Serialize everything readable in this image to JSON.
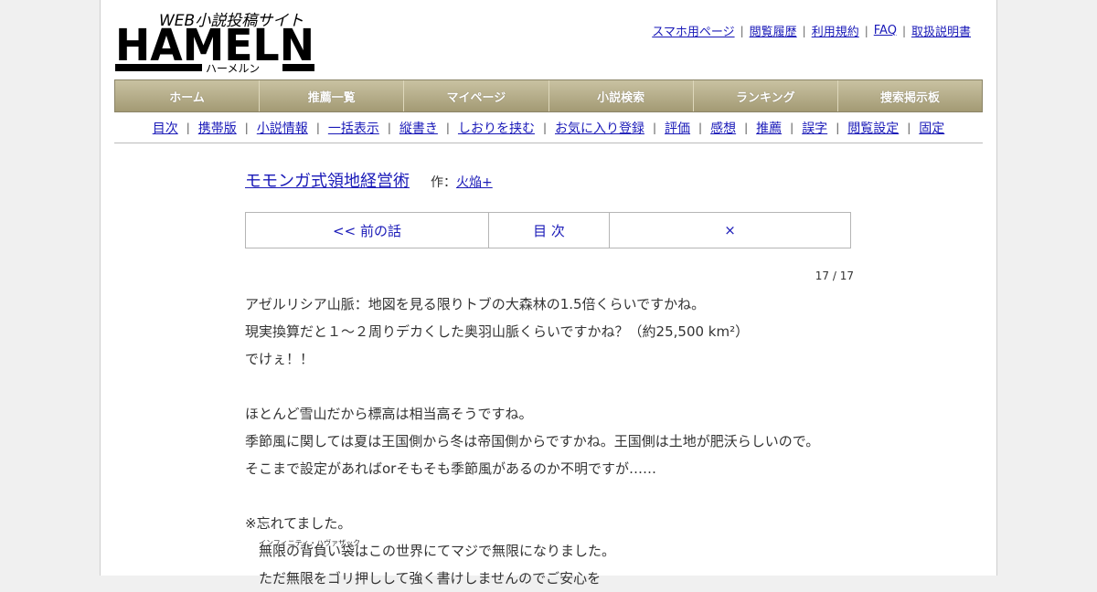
{
  "logo": {
    "tagline": "WEB小説投稿サイト",
    "wordmark": "HAMELN",
    "reading": "ハーメルン"
  },
  "top_links": [
    "スマホ用ページ",
    "閲覧履歴",
    "利用規約",
    "FAQ",
    "取扱説明書"
  ],
  "main_nav": [
    "ホーム",
    "推薦一覧",
    "マイページ",
    "小説検索",
    "ランキング",
    "捜索掲示板"
  ],
  "sub_nav": [
    "目次",
    "携帯版",
    "小説情報",
    "一括表示",
    "縦書き",
    "しおりを挟む",
    "お気に入り登録",
    "評価",
    "感想",
    "推薦",
    "誤字",
    "閲覧設定",
    "固定"
  ],
  "novel": {
    "title": "モモンガ式領地経営術",
    "author_prefix": "作：",
    "author": "火焔+"
  },
  "episode_nav": {
    "prev": "<< 前の話",
    "toc": "目 次",
    "next": "×"
  },
  "counter": "17 / 17",
  "body_lines": [
    "アゼルリシア山脈：地図を見る限りトブの大森林の1.5倍くらいですかね。",
    "現実換算だと１～２周りデカくした奥羽山脈くらいですかね？（約25,500 km²）",
    "でけぇ！！",
    "",
    "ほとんど雪山だから標高は相当高そうですね。",
    "季節風に関しては夏は王国側から冬は帝国側からですかね。王国側は土地が肥沃らしいので。",
    "そこまで設定があればorそもそも季節風があるのか不明ですが……",
    "",
    "※忘れてました。",
    "無限の背負い袋はこの世界にてマジで無限になりました。",
    "　ただ無限をゴリ押しして強く書けしませんのでご安心を"
  ],
  "ruby": "インフィニティ・ハヴァザック"
}
